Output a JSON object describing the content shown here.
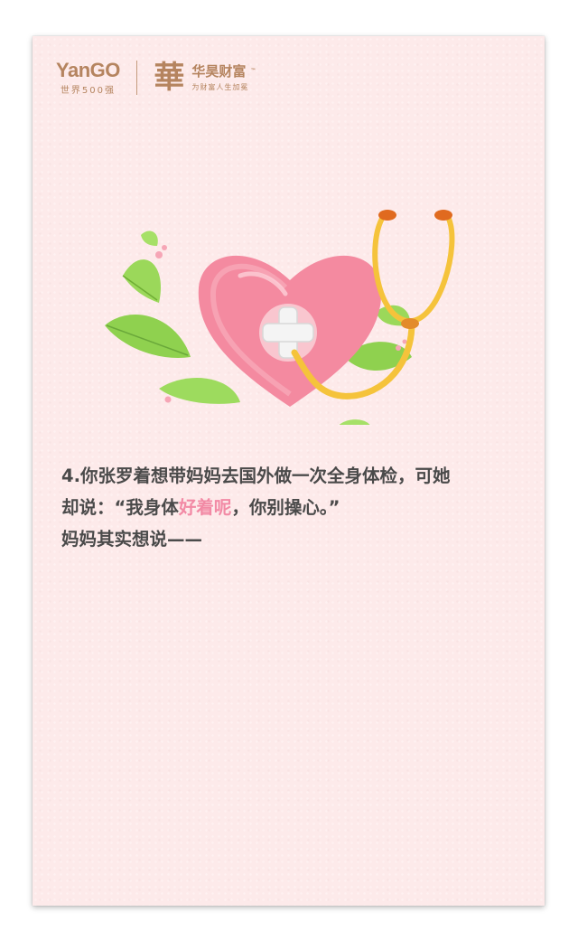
{
  "brand": {
    "yango_name": "YanGO",
    "yango_tagline": "世界500强",
    "huayu_glyph": "華",
    "huayu_name": "华昊财富",
    "huayu_tm": "™",
    "huayu_slogan": "为财富人生加冕",
    "color": "#b5845f"
  },
  "illustration": {
    "subject": "heart-with-medical-cross-and-stethoscope",
    "colors": {
      "heart": "#f48aa0",
      "leaves": "#8fd14f",
      "stethoscope": "#f5c33b",
      "stethoscope_tips": "#e06a1f"
    }
  },
  "message": {
    "line1": "4.你张罗着想带妈妈去国外做一次全身体检，可她",
    "line2_before": "却说：“我身体",
    "line2_highlight": "好着呢",
    "line2_after": "，你别操心。”",
    "line3": "妈妈其实想说——",
    "highlight_color": "#f28aa5"
  }
}
